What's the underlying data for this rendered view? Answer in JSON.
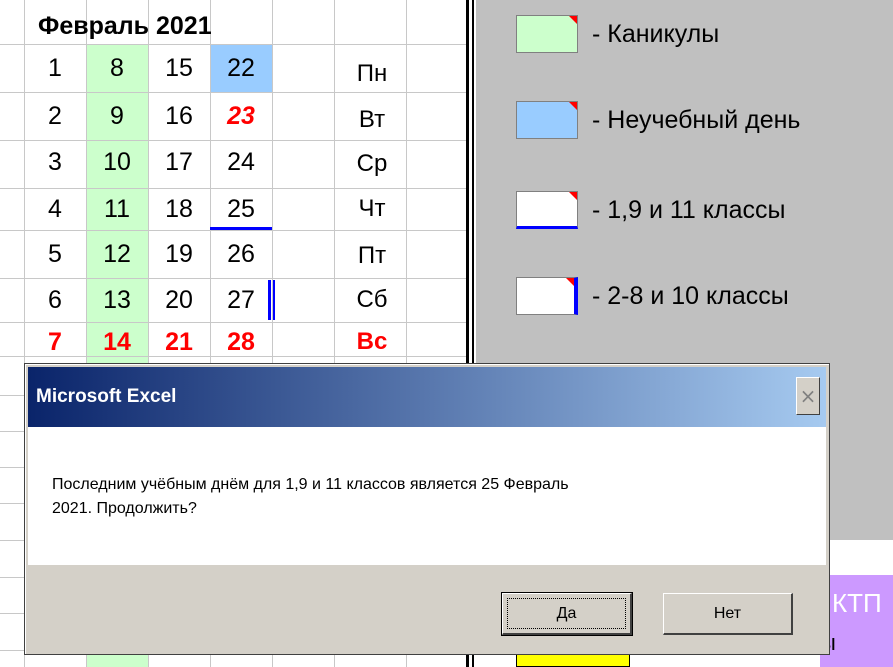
{
  "calendar": {
    "month_title": "Февраль 2021",
    "columns": [
      [
        "1",
        "2",
        "3",
        "4",
        "5",
        "6",
        "7"
      ],
      [
        "8",
        "9",
        "10",
        "11",
        "12",
        "13",
        "14"
      ],
      [
        "15",
        "16",
        "17",
        "18",
        "19",
        "20",
        "21"
      ],
      [
        "22",
        "23",
        "24",
        "25",
        "26",
        "27",
        "28"
      ]
    ],
    "weekdays": [
      "Пн",
      "Вт",
      "Ср",
      "Чт",
      "Пт",
      "Сб",
      "Вс"
    ]
  },
  "legend": {
    "holidays": "- Каникулы",
    "non_school_day": "- Неучебный день",
    "classes_1_9_11": "- 1,9 и 11 классы",
    "classes_2_8_10": "- 2-8 и 10 классы",
    "colors": {
      "holidays": "#ccffcc",
      "non_school_day": "#99ccff",
      "marker_line": "#0000ff",
      "corner": "#ff0000"
    }
  },
  "background": {
    "purple_label": "КТП",
    "partial_text": "ы"
  },
  "dialog": {
    "title": "Microsoft Excel",
    "close_icon": "×",
    "message_line1": "Последним учёбным днём для 1,9 и 11 классов является 25  Февраль",
    "message_line2": "2021. Продолжить?",
    "yes_label": "Да",
    "no_label": "Нет"
  }
}
